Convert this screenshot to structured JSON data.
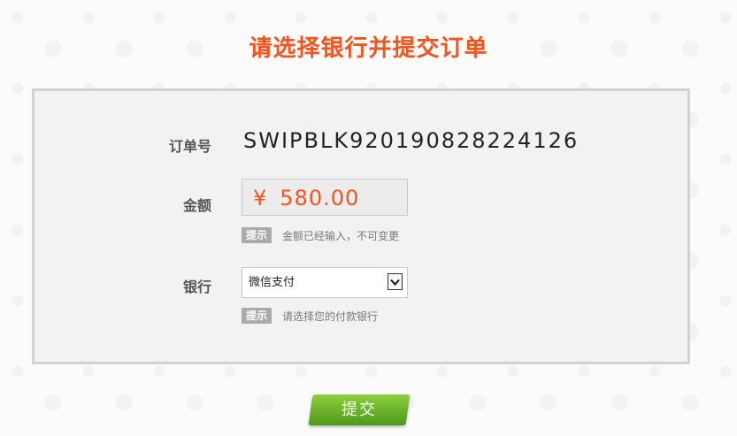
{
  "page": {
    "title": "请选择银行并提交订单"
  },
  "order": {
    "label": "订单号",
    "value": "SWIPBLK920190828224126"
  },
  "amount": {
    "label": "金额",
    "currency_symbol": "¥",
    "value": "580.00",
    "hint_tag": "提示",
    "hint_text": "金额已经输入，不可变更"
  },
  "bank": {
    "label": "银行",
    "selected": "微信支付",
    "hint_tag": "提示",
    "hint_text": "请选择您的付款银行"
  },
  "submit": {
    "label": "提交"
  },
  "colors": {
    "accent": "#f0551e",
    "button": "#6ab42a",
    "hint_tag_bg": "#aaaaaa"
  },
  "icons": {
    "select_arrow": "chevron-down-icon"
  }
}
